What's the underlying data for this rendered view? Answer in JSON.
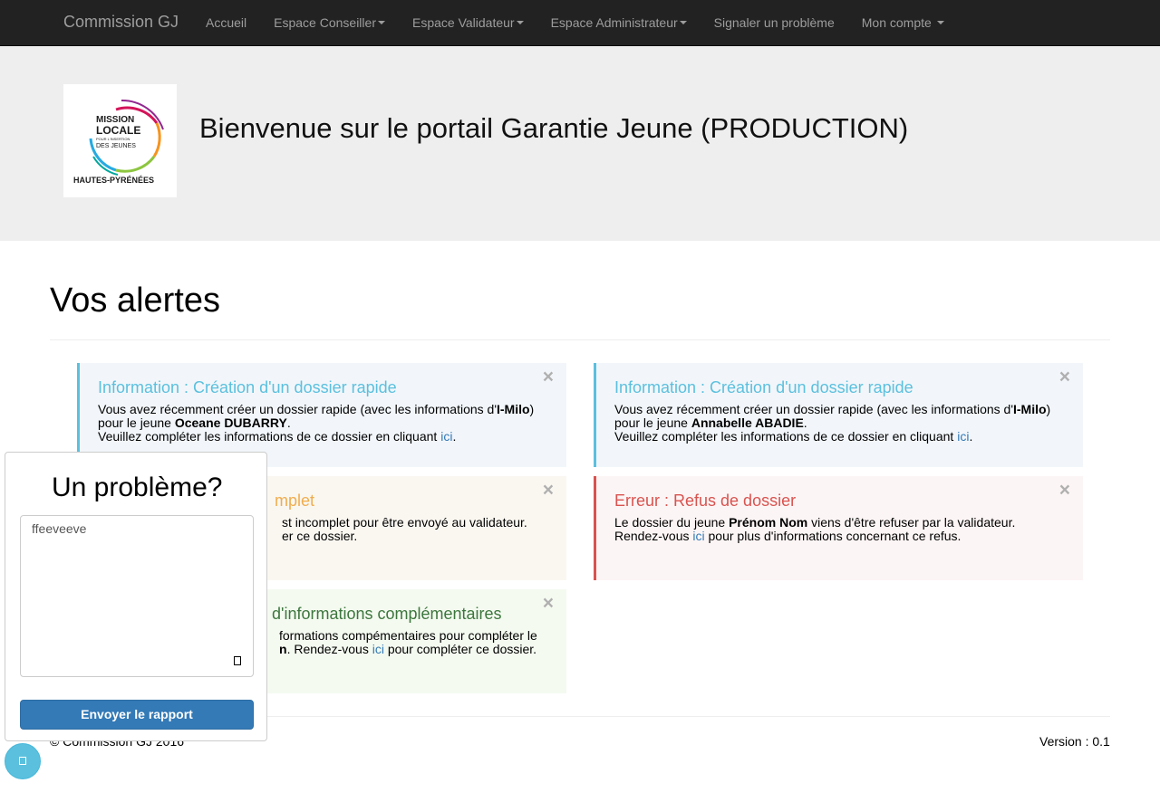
{
  "navbar": {
    "brand": "Commission GJ",
    "items": [
      {
        "label": "Accueil"
      },
      {
        "label": "Espace Conseiller"
      },
      {
        "label": "Espace Validateur"
      },
      {
        "label": "Espace Administrateur"
      },
      {
        "label": "Signaler un problème"
      },
      {
        "label": "Mon compte"
      }
    ]
  },
  "jumbotron": {
    "logo_text": [
      "MISSION",
      "LOCALE",
      "POUR L'INSERTION",
      "DES JEUNES",
      "HAUTES-PYRÉNÉES"
    ],
    "title": "Bienvenue sur le portail Garantie Jeune (PRODUCTION)"
  },
  "main": {
    "title": "Vos alertes",
    "alerts": [
      {
        "heading": "Information : Création d'un dossier rapide",
        "line1": "Vous avez récemment créer un dossier rapide (avec les informations d'",
        "line1_bold": "I-Milo",
        "line1_end": ")",
        "line2": "pour le jeune ",
        "line2_bold": "Oceane DUBARRY",
        "line2_end": ".",
        "line3": "Veuillez compléter les informations de ce dossier en cliquant ",
        "link": "ici",
        "line3_end": ".",
        "close": "×"
      },
      {
        "heading": "Information : Création d'un dossier rapide",
        "line1": "Vous avez récemment créer un dossier rapide (avec les informations d'",
        "line1_bold": "I-Milo",
        "line1_end": ")",
        "line2": "pour le jeune ",
        "line2_bold": "Annabelle ABADIE",
        "line2_end": ".",
        "line3": "Veuillez compléter les informations de ce dossier en cliquant ",
        "link": "ici",
        "line3_end": ".",
        "close": "×"
      },
      {
        "heading": "mplet",
        "line1": "st incomplet pour être envoyé au validateur.",
        "line2": "er ce dossier.",
        "close": "×"
      },
      {
        "heading": "Erreur : Refus de dossier",
        "line1": "Le dossier du jeune ",
        "line1_bold": "Prénom Nom",
        "line1_end": " viens d'être refuser par la validateur.",
        "line2": "Rendez-vous ",
        "link": "ici",
        "line2_end": " pour plus d'informations concernant ce refus.",
        "close": "×"
      },
      {
        "heading": "d'informations complémentaires",
        "line1": "formations compémentaires pour compléter le",
        "line2_bold": "n",
        "line2": ". Rendez-vous ",
        "link": "ici",
        "line2_end": " pour compléter ce dossier.",
        "close": "×"
      }
    ]
  },
  "footer": {
    "copyright": "© Commission GJ 2016",
    "version": "Version : 0.1"
  },
  "report": {
    "title": "Un problème?",
    "textarea_value": "ffeeveeve",
    "send_label": "Envoyer le rapport"
  },
  "colors": {
    "navbar_bg": "#222222",
    "info": "#5bc0de",
    "warning": "#f0ad4e",
    "danger": "#d9534f",
    "success": "#3c763d",
    "primary": "#337ab7"
  }
}
